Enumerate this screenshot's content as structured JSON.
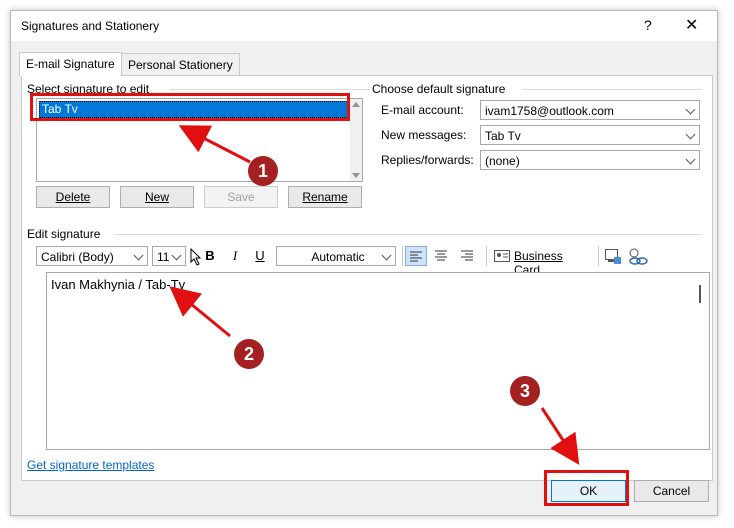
{
  "window": {
    "title": "Signatures and Stationery",
    "help_glyph": "?",
    "close_glyph": "✕"
  },
  "tabs": [
    {
      "label": "E-mail Signature",
      "active": true
    },
    {
      "label": "Personal Stationery",
      "active": false
    }
  ],
  "select_section": {
    "label": "Select signature to edit",
    "signatures": [
      "Tab Tv"
    ],
    "buttons": {
      "delete": "Delete",
      "new": "New",
      "save": "Save",
      "rename": "Rename"
    }
  },
  "default_section": {
    "label": "Choose default signature",
    "email_account_label": "E-mail account:",
    "email_account_value": "ivam1758@outlook.com",
    "new_messages_label": "New messages:",
    "new_messages_value": "Tab Tv",
    "replies_label": "Replies/forwards:",
    "replies_value": "(none)"
  },
  "edit_section": {
    "label": "Edit signature",
    "font_value": "Calibri (Body)",
    "size_value": "11",
    "bold_label": "B",
    "italic_label": "I",
    "underline_label": "U",
    "color_value": "Automatic",
    "business_card_label": "Business Card",
    "signature_text": "Ivan Makhynia / Tab-Tv"
  },
  "templates_link": "Get signature templates",
  "footer": {
    "ok_label": "OK",
    "cancel_label": "Cancel"
  },
  "annotations": [
    "1",
    "2",
    "3"
  ],
  "colors": {
    "accent_red": "#e01010",
    "badge": "#a52020",
    "selection": "#0078d7"
  }
}
